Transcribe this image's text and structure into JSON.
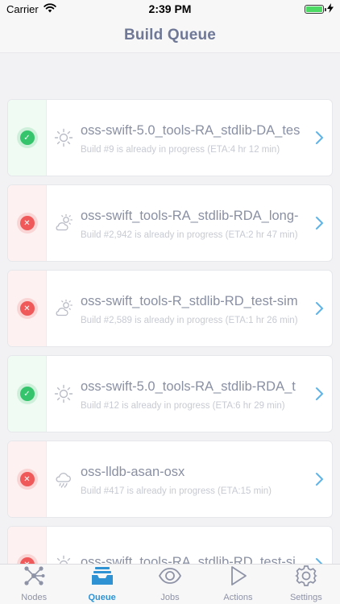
{
  "status_bar": {
    "carrier": "Carrier",
    "time": "2:39 PM",
    "battery_level": 1.0
  },
  "nav": {
    "title": "Build Queue"
  },
  "queue": [
    {
      "status": "success",
      "weather": "sunny-icon",
      "name": "oss-swift-5.0_tools-RA_stdlib-DA_tes",
      "info": "Build #9 is already in progress (ETA:4 hr 12 min)"
    },
    {
      "status": "failure",
      "weather": "partly-cloudy-icon",
      "name": "oss-swift_tools-RA_stdlib-RDA_long-",
      "info": "Build #2,942 is already in progress (ETA:2 hr 47 min)"
    },
    {
      "status": "failure",
      "weather": "partly-cloudy-icon",
      "name": "oss-swift_tools-R_stdlib-RD_test-sim",
      "info": "Build #2,589 is already in progress (ETA:1 hr 26 min)"
    },
    {
      "status": "success",
      "weather": "sunny-icon",
      "name": "oss-swift-5.0_tools-RA_stdlib-RDA_t",
      "info": "Build #12 is already in progress (ETA:6 hr 29 min)"
    },
    {
      "status": "failure",
      "weather": "rain-cloud-icon",
      "name": "oss-lldb-asan-osx",
      "info": "Build #417 is already in progress (ETA:15 min)"
    },
    {
      "status": "failure",
      "weather": "sunny-icon",
      "name": "oss-swift_tools-RA_stdlib-RD_test-si",
      "info": ""
    }
  ],
  "tabs": [
    {
      "label": "Nodes",
      "icon": "nodes-icon",
      "active": false
    },
    {
      "label": "Queue",
      "icon": "queue-tray-icon",
      "active": true
    },
    {
      "label": "Jobs",
      "icon": "eye-icon",
      "active": false
    },
    {
      "label": "Actions",
      "icon": "play-icon",
      "active": false
    },
    {
      "label": "Settings",
      "icon": "gear-icon",
      "active": false
    }
  ],
  "colors": {
    "accent": "#2f93d3",
    "success": "#35c46b",
    "failure": "#f05959",
    "title": "#6f7896",
    "chevron": "#5fb3e6"
  }
}
